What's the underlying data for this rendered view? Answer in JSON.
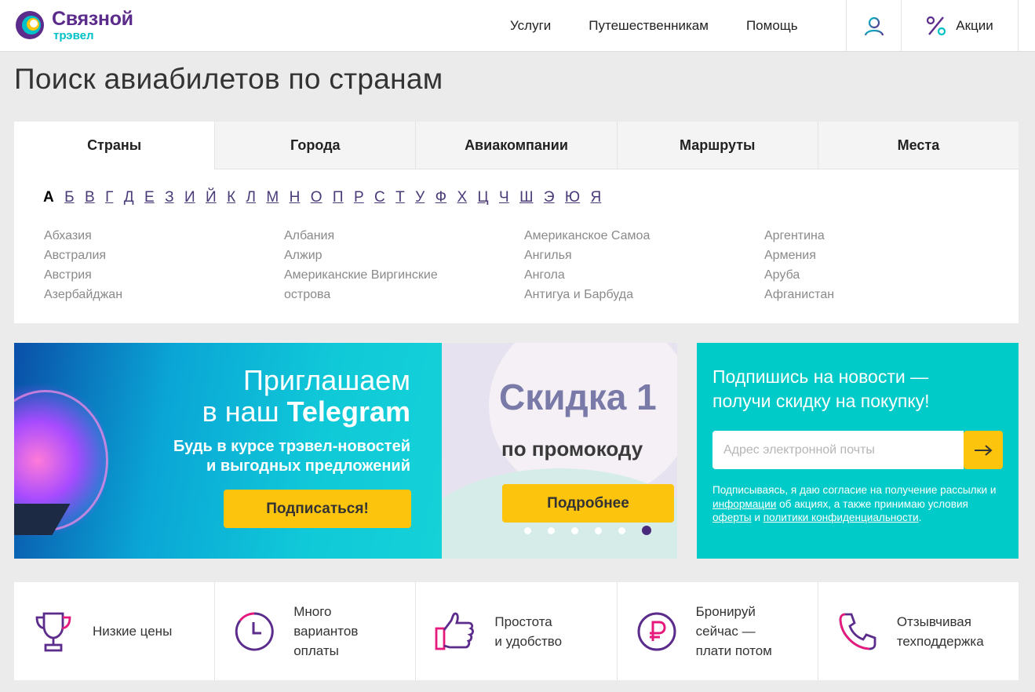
{
  "header": {
    "logo_name": "Связной",
    "logo_sub": "трэвел",
    "nav": [
      "Услуги",
      "Путешественникам",
      "Помощь"
    ],
    "promo_label": "Акции"
  },
  "page": {
    "title": "Поиск авиабилетов по странам"
  },
  "tabs": [
    "Страны",
    "Города",
    "Авиакомпании",
    "Маршруты",
    "Места"
  ],
  "letters": [
    "А",
    "Б",
    "В",
    "Г",
    "Д",
    "Е",
    "З",
    "И",
    "Й",
    "К",
    "Л",
    "М",
    "Н",
    "О",
    "П",
    "Р",
    "С",
    "Т",
    "У",
    "Ф",
    "Х",
    "Ц",
    "Ч",
    "Ш",
    "Э",
    "Ю",
    "Я"
  ],
  "countries": [
    [
      "Абхазия",
      "Австралия",
      "Австрия",
      "Азербайджан"
    ],
    [
      "Албания",
      "Алжир",
      "Американские Виргинские",
      "острова"
    ],
    [
      "Американское Самоа",
      "Ангилья",
      "Ангола",
      "Антигуа и Барбуда"
    ],
    [
      "Аргентина",
      "Армения",
      "Аруба",
      "Афганистан"
    ]
  ],
  "banner": {
    "line1": "Приглашаем",
    "line2_pre": "в наш ",
    "line2_bold": "Telegram",
    "sub1": "Будь в курсе трэвел-новостей",
    "sub2": "и выгодных предложений",
    "button": "Подписаться!",
    "promo_big": "Скидка 1",
    "promo_mid": "по промокоду",
    "promo_button": "Подробнее",
    "slides_total": 6,
    "active_slide": 6
  },
  "subscribe": {
    "title1": "Подпишись на новости —",
    "title2": "получи скидку на покупку!",
    "placeholder": "Адрес электронной почты",
    "note_1": "Подписываясь, я даю согласие на получение рассылки и ",
    "link_info": "информации",
    "note_2": " об акциях, а также принимаю условия ",
    "link_offer": "оферты",
    "note_3": " и ",
    "link_policy": "политики конфиденциальности",
    "note_4": "."
  },
  "features": [
    {
      "icon": "trophy-icon",
      "text": "Низкие цены"
    },
    {
      "icon": "clock-icon",
      "text": "Много\nвариантов\nоплаты"
    },
    {
      "icon": "thumbs-up-icon",
      "text": "Простота\nи удобство"
    },
    {
      "icon": "ruble-icon",
      "text": "Бронируй\nсейчас —\nплати потом"
    },
    {
      "icon": "phone-icon",
      "text": "Отзывчивая\nтехподдержка"
    }
  ],
  "colors": {
    "brand_purple": "#5b2c8b",
    "brand_teal": "#00cbc8",
    "accent_yellow": "#fdc40e",
    "accent_pink": "#e6197d"
  }
}
